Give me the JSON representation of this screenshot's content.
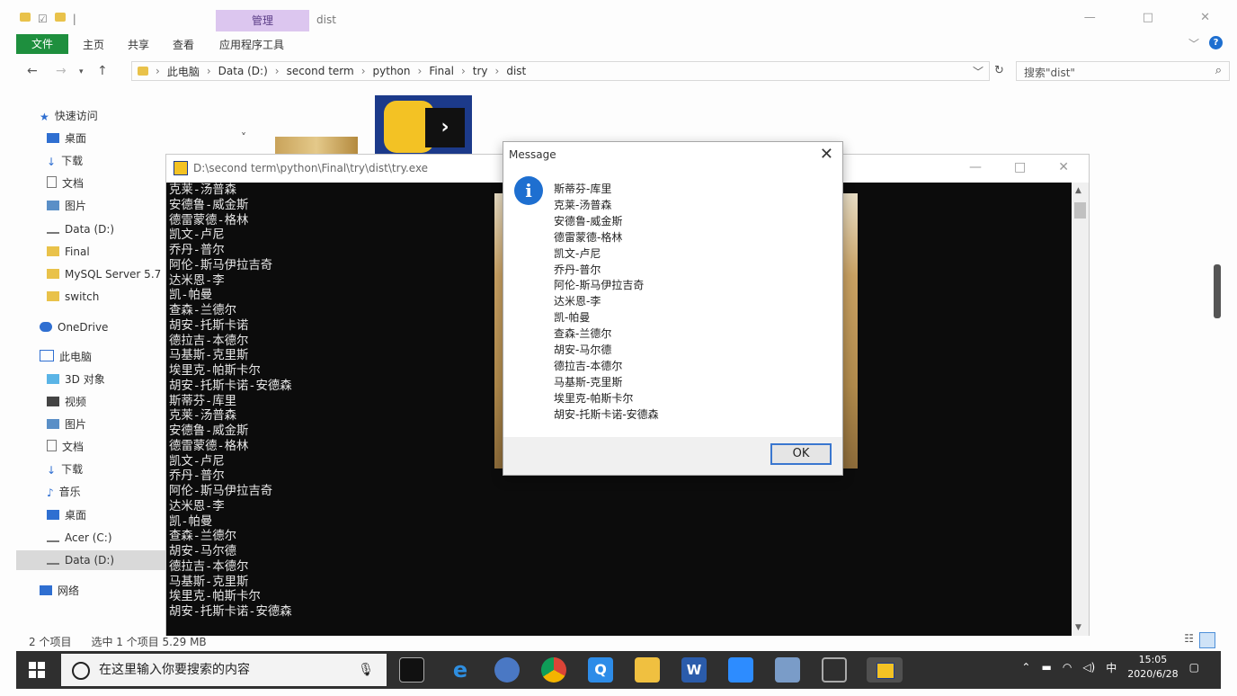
{
  "explorer": {
    "title": "dist",
    "contextual_tab": "管理",
    "ribbon_tabs": [
      "文件",
      "主页",
      "共享",
      "查看",
      "应用程序工具"
    ],
    "address_path": [
      "此电脑",
      "Data (D:)",
      "second term",
      "python",
      "Final",
      "try",
      "dist"
    ],
    "search_placeholder": "搜索\"dist\"",
    "sidebar": [
      {
        "label": "快速访问",
        "icon": "star-icon"
      },
      {
        "label": "桌面",
        "icon": "desktop-icon"
      },
      {
        "label": "下载",
        "icon": "download-icon"
      },
      {
        "label": "文档",
        "icon": "document-icon"
      },
      {
        "label": "图片",
        "icon": "pictures-icon"
      },
      {
        "label": "Data (D:)",
        "icon": "drive-icon"
      },
      {
        "label": "Final",
        "icon": "folder-icon"
      },
      {
        "label": "MySQL Server 5.7",
        "icon": "folder-icon"
      },
      {
        "label": "switch",
        "icon": "folder-icon"
      },
      {
        "label": "OneDrive",
        "icon": "cloud-icon"
      },
      {
        "label": "此电脑",
        "icon": "computer-icon"
      },
      {
        "label": "3D 对象",
        "icon": "cube-icon"
      },
      {
        "label": "视频",
        "icon": "video-icon"
      },
      {
        "label": "图片",
        "icon": "pictures-icon"
      },
      {
        "label": "文档",
        "icon": "document-icon"
      },
      {
        "label": "下载",
        "icon": "download-icon"
      },
      {
        "label": "音乐",
        "icon": "music-icon"
      },
      {
        "label": "桌面",
        "icon": "desktop-icon"
      },
      {
        "label": "Acer (C:)",
        "icon": "drive-icon"
      },
      {
        "label": "Data (D:)",
        "icon": "drive-icon"
      },
      {
        "label": "网络",
        "icon": "network-icon"
      }
    ],
    "status_items": "2 个项目",
    "status_selected": "选中 1 个项目  5.29 MB"
  },
  "console": {
    "title": "D:\\second term\\python\\Final\\try\\dist\\try.exe",
    "lines": [
      "克莱-汤普森",
      "安德鲁-威金斯",
      "德雷蒙德-格林",
      "凯文-卢尼",
      "乔丹-普尔",
      "阿伦-斯马伊拉吉奇",
      "达米恩-李",
      "凯-帕曼",
      "查森-兰德尔",
      "胡安-托斯卡诺",
      "德拉吉-本德尔",
      "马基斯-克里斯",
      "埃里克-帕斯卡尔",
      "胡安-托斯卡诺-安德森",
      "斯蒂芬-库里",
      "克莱-汤普森",
      "安德鲁-威金斯",
      "德雷蒙德-格林",
      "凯文-卢尼",
      "乔丹-普尔",
      "阿伦-斯马伊拉吉奇",
      "达米恩-李",
      "凯-帕曼",
      "查森-兰德尔",
      "胡安-马尔德",
      "德拉吉-本德尔",
      "马基斯-克里斯",
      "埃里克-帕斯卡尔",
      "胡安-托斯卡诺-安德森"
    ]
  },
  "message_box": {
    "title": "Message",
    "lines": [
      "斯蒂芬-库里",
      "克莱-汤普森",
      "安德鲁-威金斯",
      "德雷蒙德-格林",
      "凯文-卢尼",
      "乔丹-普尔",
      "阿伦-斯马伊拉吉奇",
      "达米恩-李",
      "凯-帕曼",
      "查森-兰德尔",
      "胡安-马尔德",
      "德拉吉-本德尔",
      "马基斯-克里斯",
      "埃里克-帕斯卡尔",
      "胡安-托斯卡诺-安德森"
    ],
    "ok_label": "OK"
  },
  "taskbar": {
    "search_placeholder": "在这里输入你要搜索的内容",
    "apps": [
      "terminal-icon",
      "edge-icon",
      "python-idle-icon",
      "chrome-icon",
      "qq-icon",
      "file-explorer-icon",
      "word-icon",
      "zoom-icon",
      "network-app-icon",
      "console-app-icon",
      "python-exe-icon"
    ],
    "ime": "中",
    "time": "15:05",
    "date": "2020/6/28"
  },
  "colors": {
    "file_tab": "#1e8f3e",
    "contextual_tab": "#dcc6ef",
    "info_icon": "#1e6fd0",
    "taskbar": "#2f2f2f",
    "console_bg": "#0c0c0c"
  }
}
